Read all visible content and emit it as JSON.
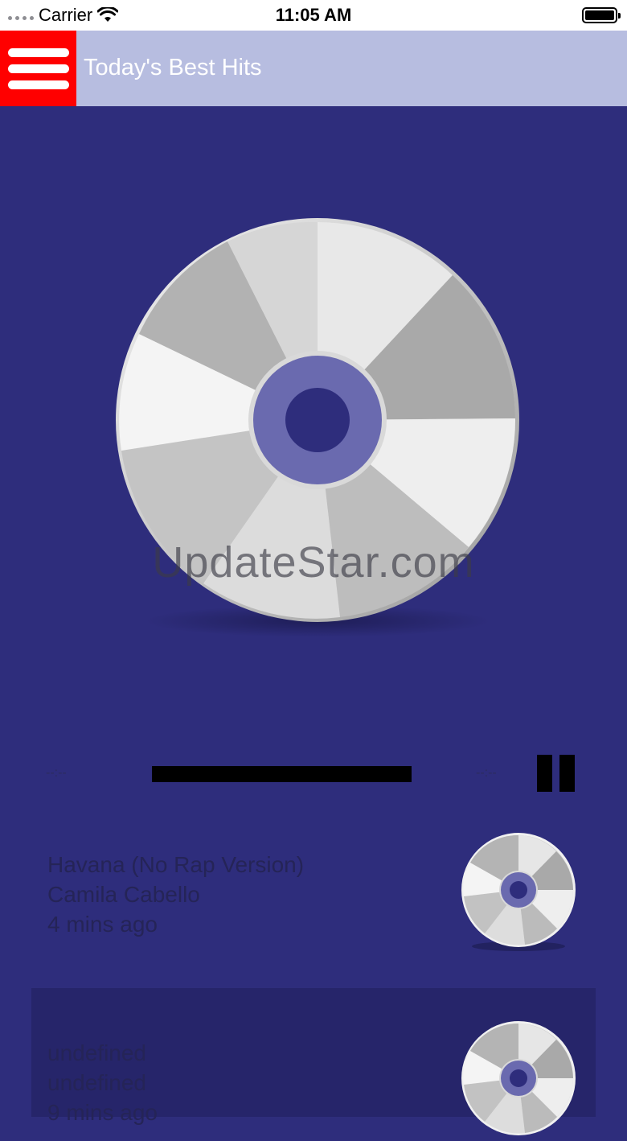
{
  "status_bar": {
    "carrier": "Carrier",
    "time": "11:05 AM"
  },
  "header": {
    "title": "Today's Best Hits"
  },
  "player": {
    "watermark": "UpdateStar.com",
    "elapsed": "--:--",
    "remaining": "--:--"
  },
  "tracks": [
    {
      "title": "Havana (No Rap Version)",
      "artist": "Camila Cabello",
      "played": "4 mins ago"
    },
    {
      "title": "undefined",
      "artist": "undefined",
      "played": "9 mins ago"
    }
  ],
  "colors": {
    "background": "#2e2d7c",
    "header": "#b7bde0",
    "menu_button": "#ff0000",
    "disc_hub": "#6a6aaf"
  }
}
